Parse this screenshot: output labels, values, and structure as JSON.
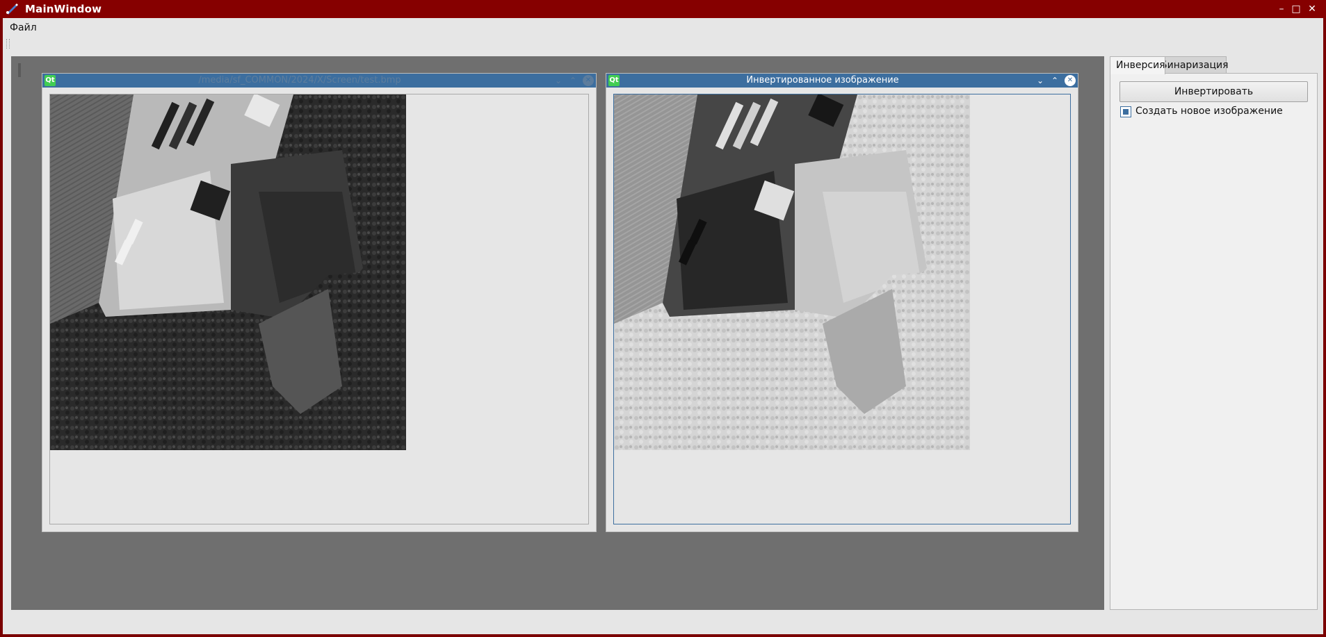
{
  "window": {
    "title": "MainWindow",
    "minimize_glyph": "–",
    "maximize_glyph": "□",
    "close_glyph": "✕"
  },
  "menu": {
    "file": "Файл"
  },
  "subwindows": [
    {
      "title": "/media/sf_COMMON/2024/X/Screen/test.bmp",
      "icon": "Qt",
      "state": "inactive",
      "image": "original-grayscale-aerial-photo"
    },
    {
      "title": "Инвертированное изображение",
      "icon": "Qt",
      "state": "active",
      "image": "inverted-grayscale-aerial-photo"
    }
  ],
  "side_panel": {
    "tabs": [
      "Инверсия",
      "Бинаризация"
    ],
    "selected_tab": "Инверсия",
    "invert_button": "Инвертировать",
    "new_image_checkbox": {
      "label": "Создать новое изображение",
      "checked": true
    }
  },
  "colors": {
    "title_bar": "#860000",
    "subwindow_title": "#3c6e9f",
    "mdi_background": "#6f6f6f",
    "qt_icon": "#41cd52"
  }
}
